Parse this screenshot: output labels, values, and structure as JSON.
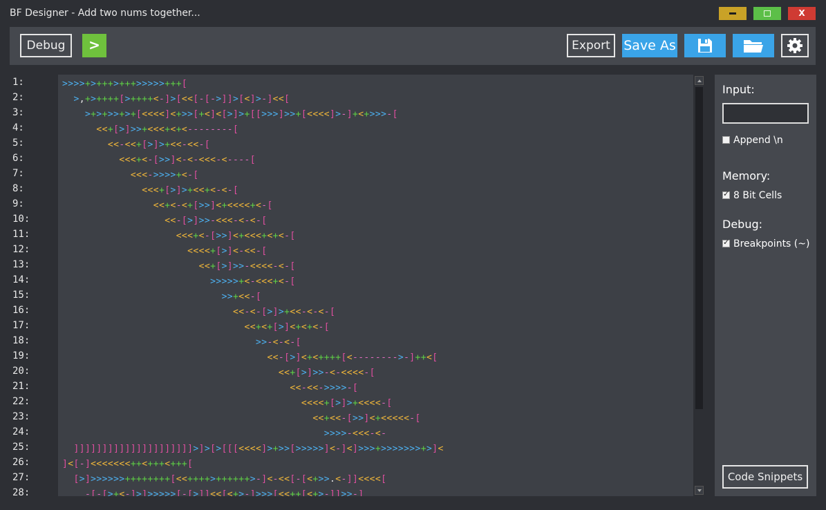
{
  "window": {
    "title": "BF Designer - Add two nums together...",
    "minimize": "",
    "maximize": "",
    "close": "X"
  },
  "toolbar": {
    "debug_label": "Debug",
    "run_label": ">",
    "export_label": "Export",
    "saveas_label": "Save As",
    "save_icon": "floppy-disk-icon",
    "open_icon": "folder-icon",
    "settings_icon": "gear-icon"
  },
  "editor": {
    "line_numbers": [
      "1:",
      "2:",
      "3:",
      "4:",
      "5:",
      "6:",
      "7:",
      "8:",
      "9:",
      "10:",
      "11:",
      "12:",
      "13:",
      "14:",
      "15:",
      "16:",
      "17:",
      "18:",
      "19:",
      "20:",
      "21:",
      "22:",
      "23:",
      "24:",
      "25:",
      "26:",
      "27:",
      "28:"
    ],
    "lines": [
      ">>>>+>+++>+++>>>>>+++[",
      "  >,+>++++[>++++<-]>[<<[-[->]]>[<]>-]<<[",
      "    >+>+>>+>+[<<<<]<+>>[+<]<[>]>+[[>>>]>>+[<<<<]>-]+<+>>>-[",
      "      <<+[>]>>+<<<+<+<--------[",
      "        <<-<<+[>]>+<<-<<-[",
      "          <<<+<-[>>]<-<-<<<-<----[",
      "            <<<->>>>+<-[",
      "              <<<+[>]>+<<+<-<-[",
      "                <<+<-<+[>>]<+<<<<+<-[",
      "                  <<-[>]>>-<<<-<-<-[",
      "                    <<<+<-[>>]<+<<<+<+<-[",
      "                      <<<<+[>]<-<<-[",
      "                        <<+[>]>>-<<<<-<-[",
      "                          >>>>>+<-<<<+<-[",
      "                            >>+<<-[",
      "                              <<-<-[>]>+<<-<-<-[",
      "                                <<+<+[>]<+<+<-[",
      "                                  >>-<-<-[",
      "                                    <<-[>]<+<++++[<-------->-]++<[",
      "                                      <<+[>]>>-<-<<<<-[",
      "                                        <<-<<->>>>-[",
      "                                          <<<<+[>]>+<<<<-[",
      "                                            <<+<<-[>>]<+<<<<<-[",
      "                                              >>>>-<<<-<-",
      "  ]]]]]]]]]]]]]]]]]]]]]>]>[>[[[<<<<]>+>>[>>>>>]<-]<]>>>+>>>>>>>+>]<",
      "]<[-]<<<<<<<++<+++<+++[",
      "  [>]>>>>>>++++++++[<<++++>++++++>-]<-<<[-[<+>>.<-]]<<<<[",
      "    -[-[>+<-]>]>>>>>[-[>]]<<[<+>-]>>>[<<++[<+>-]]>>-]"
    ]
  },
  "sidebar": {
    "input_label": "Input:",
    "input_value": "",
    "append_label": "Append \\n",
    "append_checked": false,
    "memory_label": "Memory:",
    "bitcells_label": "8 Bit Cells",
    "bitcells_checked": true,
    "debug_label": "Debug:",
    "breakpoints_label": "Breakpoints (~)",
    "breakpoints_checked": true,
    "snippets_label": "Code Snippets"
  },
  "colors": {
    "gt": "#4db0f0",
    "lt": "#f0b63a",
    "plus": "#5fcf45",
    "minus": "#e06bbf",
    "bracket": "#e04fa0",
    "accent": "#3aa4e8",
    "run": "#6fc13d"
  }
}
